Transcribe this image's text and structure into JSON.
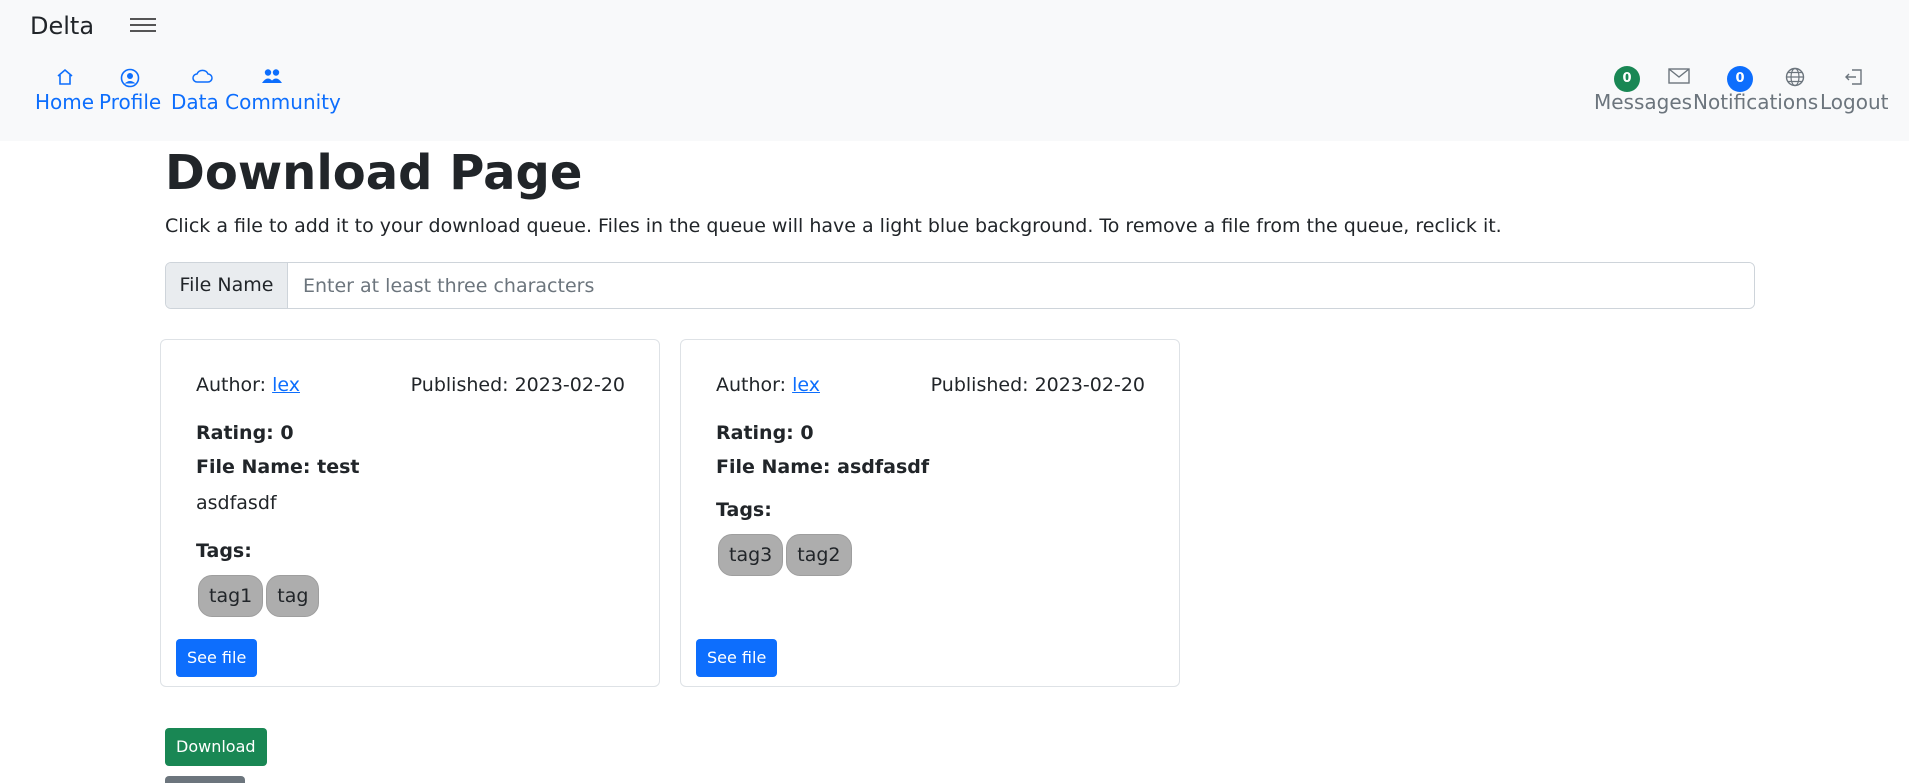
{
  "navbar": {
    "brand": "Delta",
    "left_items": [
      {
        "label": "Home",
        "icon": "home-icon"
      },
      {
        "label": "Profile",
        "icon": "profile-icon"
      },
      {
        "label": "Data Community",
        "icon": "cloud-icon"
      }
    ],
    "right_items": [
      {
        "label": "Messages",
        "icon": "envelope-icon",
        "badge": "0",
        "badge_color": "#198754"
      },
      {
        "label": "Notifications",
        "icon": "globe-icon",
        "badge": "0",
        "badge_color": "#0d6efd"
      },
      {
        "label": "Logout",
        "icon": "logout-icon"
      }
    ]
  },
  "main": {
    "title": "Download Page",
    "intro": "Click a file to add it to your download queue. Files in the queue will have a light blue background. To remove a file from the queue, reclick it.",
    "search": {
      "label": "File Name",
      "placeholder": "Enter at least three characters"
    },
    "cards": [
      {
        "author_prefix": "Author: ",
        "author": "lex",
        "published": "Published: 2023-02-20",
        "rating": "Rating: 0",
        "file_name": "File Name: test",
        "description": "asdfasdf",
        "tags_label": "Tags:",
        "tags": [
          "tag1",
          "tag"
        ],
        "button": "See file"
      },
      {
        "author_prefix": "Author: ",
        "author": "lex",
        "published": "Published: 2023-02-20",
        "rating": "Rating: 0",
        "file_name": "File Name: asdfasdf",
        "description": "",
        "tags_label": "Tags:",
        "tags": [
          "tag3",
          "tag2"
        ],
        "button": "See file"
      }
    ],
    "download_button": "Download"
  },
  "colors": {
    "primary": "#0d6efd",
    "success": "#198754",
    "tag_bg": "#adadad",
    "navbar_bg": "#f8f9fa"
  }
}
